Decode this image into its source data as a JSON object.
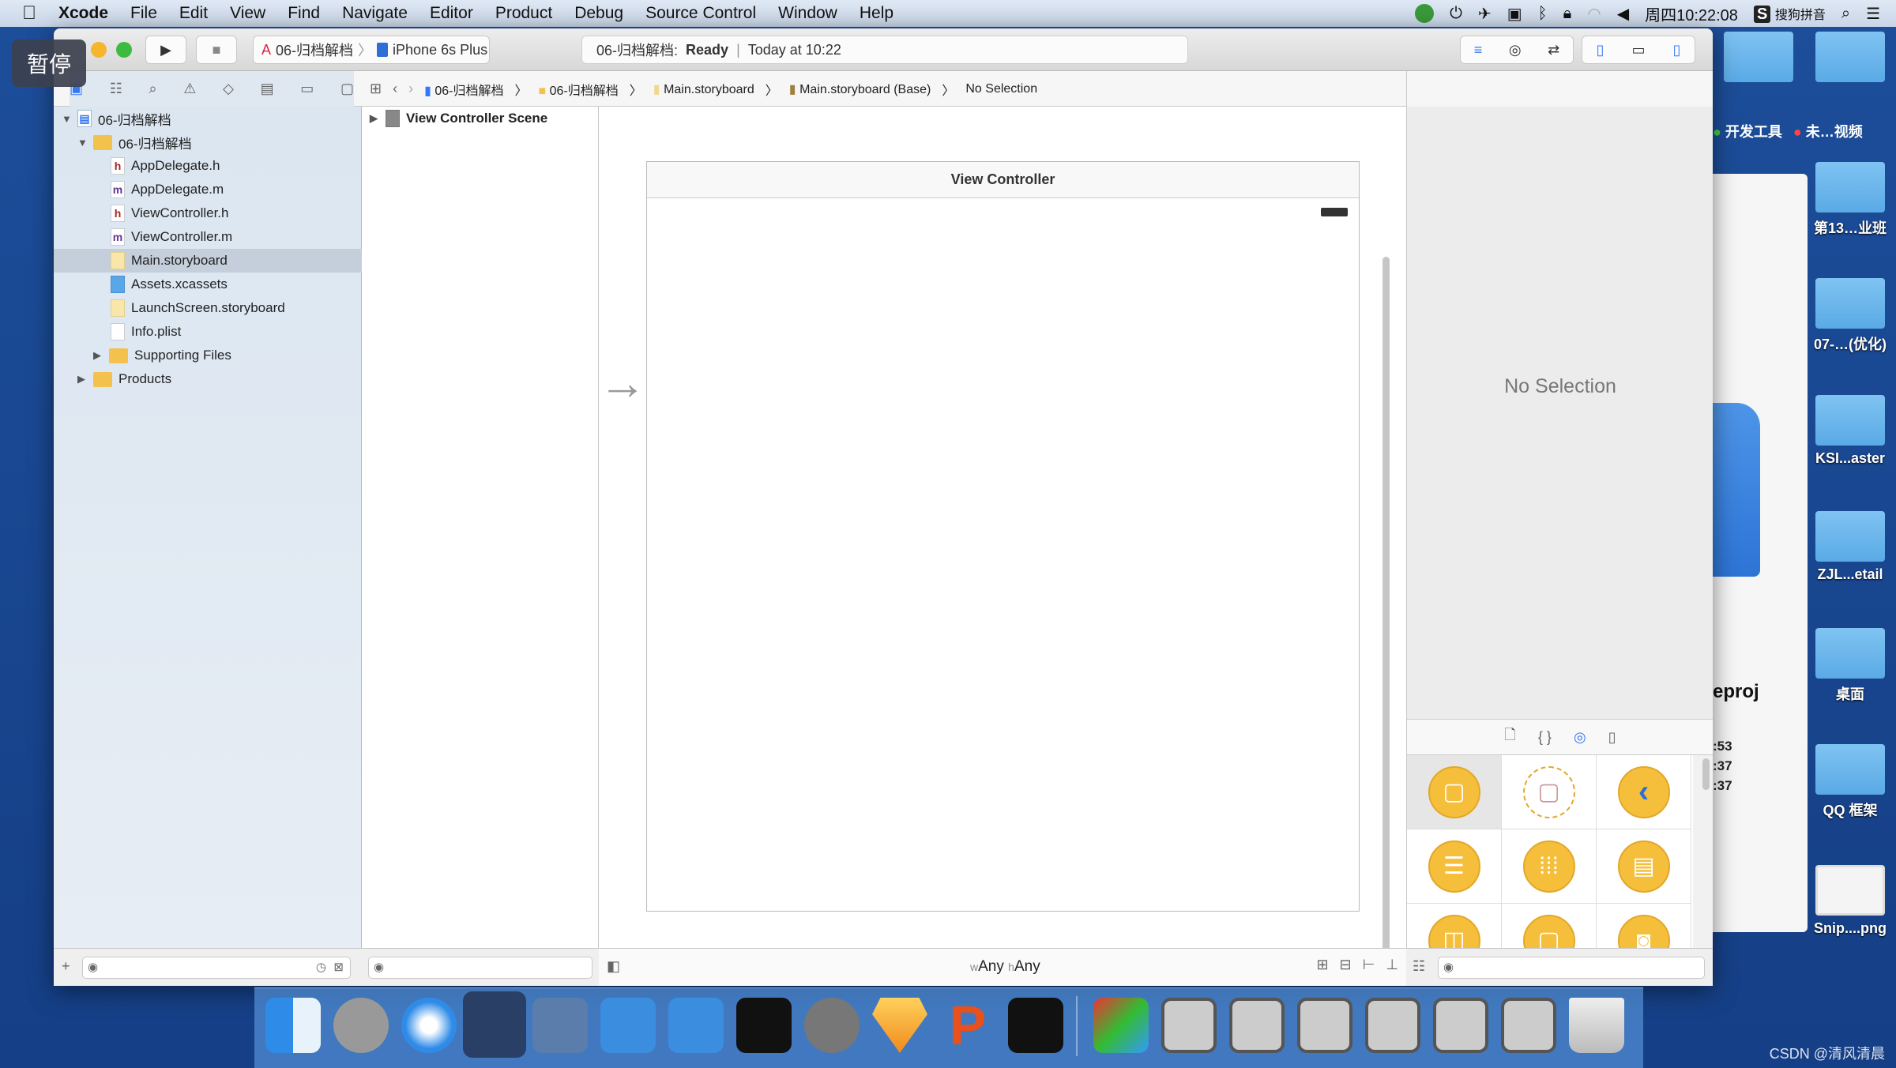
{
  "menubar": {
    "app": "Xcode",
    "items": [
      "File",
      "Edit",
      "View",
      "Find",
      "Navigate",
      "Editor",
      "Product",
      "Debug",
      "Source Control",
      "Window",
      "Help"
    ],
    "clock": "周四10:22:08",
    "input_method": "搜狗拼音"
  },
  "overlay": {
    "pause": "暂停"
  },
  "toolbar": {
    "scheme": "06-归档解档",
    "device": "iPhone 6s Plus",
    "activity_project": "06-归档解档:",
    "activity_status": "Ready",
    "activity_time": "Today at 10:22"
  },
  "jumpbar": [
    "06-归档解档",
    "06-归档解档",
    "Main.storyboard",
    "Main.storyboard (Base)",
    "No Selection"
  ],
  "navigator": {
    "items": [
      {
        "label": "06-归档解档",
        "type": "project"
      },
      {
        "label": "06-归档解档",
        "type": "folder"
      },
      {
        "label": "AppDelegate.h",
        "type": "h"
      },
      {
        "label": "AppDelegate.m",
        "type": "m"
      },
      {
        "label": "ViewController.h",
        "type": "h"
      },
      {
        "label": "ViewController.m",
        "type": "m"
      },
      {
        "label": "Main.storyboard",
        "type": "storyboard",
        "selected": true
      },
      {
        "label": "Assets.xcassets",
        "type": "assets"
      },
      {
        "label": "LaunchScreen.storyboard",
        "type": "storyboard"
      },
      {
        "label": "Info.plist",
        "type": "plist"
      },
      {
        "label": "Supporting Files",
        "type": "folder"
      },
      {
        "label": "Products",
        "type": "folder"
      }
    ]
  },
  "outline": {
    "scene": "View Controller Scene"
  },
  "canvas": {
    "vc_title": "View Controller",
    "size_class_w": "w",
    "size_class_w_val": "Any",
    "size_class_h": "h",
    "size_class_h_val": "Any"
  },
  "inspector": {
    "empty": "No Selection"
  },
  "desktop": {
    "tags": [
      "开发工具",
      "未…视频"
    ],
    "items": [
      "第13…业班",
      "07-…(优化)",
      "KSI...aster",
      "ZJL...etail",
      "桌面",
      "QQ 框架",
      "Snip....png"
    ],
    "behind_window": {
      "title_fragment": "eproj",
      "lines": [
        ":53",
        ":37",
        ":37"
      ]
    }
  },
  "watermark": "CSDN @清风清晨",
  "colors": {
    "accent": "#3478f6",
    "library_yellow": "#f5bf3b",
    "desktop": "#1d4e9a"
  }
}
